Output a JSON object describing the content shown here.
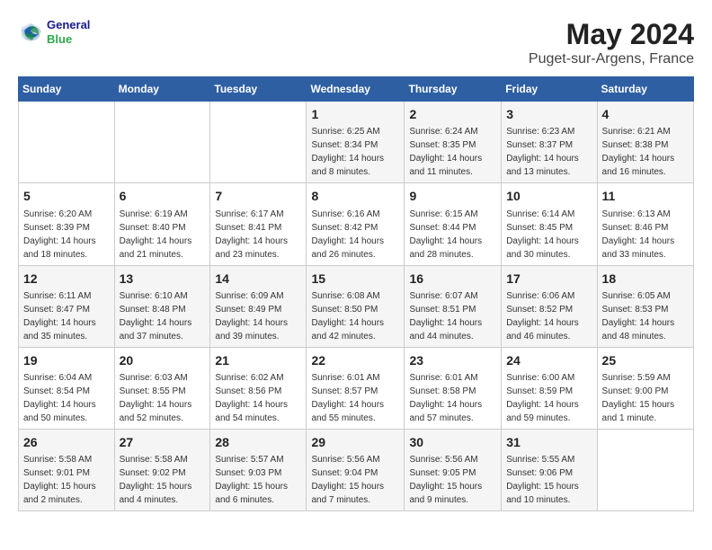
{
  "header": {
    "logo_line1": "General",
    "logo_line2": "Blue",
    "title": "May 2024",
    "subtitle": "Puget-sur-Argens, France"
  },
  "days_of_week": [
    "Sunday",
    "Monday",
    "Tuesday",
    "Wednesday",
    "Thursday",
    "Friday",
    "Saturday"
  ],
  "weeks": [
    [
      {
        "day": "",
        "sunrise": "",
        "sunset": "",
        "daylight": ""
      },
      {
        "day": "",
        "sunrise": "",
        "sunset": "",
        "daylight": ""
      },
      {
        "day": "",
        "sunrise": "",
        "sunset": "",
        "daylight": ""
      },
      {
        "day": "1",
        "sunrise": "Sunrise: 6:25 AM",
        "sunset": "Sunset: 8:34 PM",
        "daylight": "Daylight: 14 hours and 8 minutes."
      },
      {
        "day": "2",
        "sunrise": "Sunrise: 6:24 AM",
        "sunset": "Sunset: 8:35 PM",
        "daylight": "Daylight: 14 hours and 11 minutes."
      },
      {
        "day": "3",
        "sunrise": "Sunrise: 6:23 AM",
        "sunset": "Sunset: 8:37 PM",
        "daylight": "Daylight: 14 hours and 13 minutes."
      },
      {
        "day": "4",
        "sunrise": "Sunrise: 6:21 AM",
        "sunset": "Sunset: 8:38 PM",
        "daylight": "Daylight: 14 hours and 16 minutes."
      }
    ],
    [
      {
        "day": "5",
        "sunrise": "Sunrise: 6:20 AM",
        "sunset": "Sunset: 8:39 PM",
        "daylight": "Daylight: 14 hours and 18 minutes."
      },
      {
        "day": "6",
        "sunrise": "Sunrise: 6:19 AM",
        "sunset": "Sunset: 8:40 PM",
        "daylight": "Daylight: 14 hours and 21 minutes."
      },
      {
        "day": "7",
        "sunrise": "Sunrise: 6:17 AM",
        "sunset": "Sunset: 8:41 PM",
        "daylight": "Daylight: 14 hours and 23 minutes."
      },
      {
        "day": "8",
        "sunrise": "Sunrise: 6:16 AM",
        "sunset": "Sunset: 8:42 PM",
        "daylight": "Daylight: 14 hours and 26 minutes."
      },
      {
        "day": "9",
        "sunrise": "Sunrise: 6:15 AM",
        "sunset": "Sunset: 8:44 PM",
        "daylight": "Daylight: 14 hours and 28 minutes."
      },
      {
        "day": "10",
        "sunrise": "Sunrise: 6:14 AM",
        "sunset": "Sunset: 8:45 PM",
        "daylight": "Daylight: 14 hours and 30 minutes."
      },
      {
        "day": "11",
        "sunrise": "Sunrise: 6:13 AM",
        "sunset": "Sunset: 8:46 PM",
        "daylight": "Daylight: 14 hours and 33 minutes."
      }
    ],
    [
      {
        "day": "12",
        "sunrise": "Sunrise: 6:11 AM",
        "sunset": "Sunset: 8:47 PM",
        "daylight": "Daylight: 14 hours and 35 minutes."
      },
      {
        "day": "13",
        "sunrise": "Sunrise: 6:10 AM",
        "sunset": "Sunset: 8:48 PM",
        "daylight": "Daylight: 14 hours and 37 minutes."
      },
      {
        "day": "14",
        "sunrise": "Sunrise: 6:09 AM",
        "sunset": "Sunset: 8:49 PM",
        "daylight": "Daylight: 14 hours and 39 minutes."
      },
      {
        "day": "15",
        "sunrise": "Sunrise: 6:08 AM",
        "sunset": "Sunset: 8:50 PM",
        "daylight": "Daylight: 14 hours and 42 minutes."
      },
      {
        "day": "16",
        "sunrise": "Sunrise: 6:07 AM",
        "sunset": "Sunset: 8:51 PM",
        "daylight": "Daylight: 14 hours and 44 minutes."
      },
      {
        "day": "17",
        "sunrise": "Sunrise: 6:06 AM",
        "sunset": "Sunset: 8:52 PM",
        "daylight": "Daylight: 14 hours and 46 minutes."
      },
      {
        "day": "18",
        "sunrise": "Sunrise: 6:05 AM",
        "sunset": "Sunset: 8:53 PM",
        "daylight": "Daylight: 14 hours and 48 minutes."
      }
    ],
    [
      {
        "day": "19",
        "sunrise": "Sunrise: 6:04 AM",
        "sunset": "Sunset: 8:54 PM",
        "daylight": "Daylight: 14 hours and 50 minutes."
      },
      {
        "day": "20",
        "sunrise": "Sunrise: 6:03 AM",
        "sunset": "Sunset: 8:55 PM",
        "daylight": "Daylight: 14 hours and 52 minutes."
      },
      {
        "day": "21",
        "sunrise": "Sunrise: 6:02 AM",
        "sunset": "Sunset: 8:56 PM",
        "daylight": "Daylight: 14 hours and 54 minutes."
      },
      {
        "day": "22",
        "sunrise": "Sunrise: 6:01 AM",
        "sunset": "Sunset: 8:57 PM",
        "daylight": "Daylight: 14 hours and 55 minutes."
      },
      {
        "day": "23",
        "sunrise": "Sunrise: 6:01 AM",
        "sunset": "Sunset: 8:58 PM",
        "daylight": "Daylight: 14 hours and 57 minutes."
      },
      {
        "day": "24",
        "sunrise": "Sunrise: 6:00 AM",
        "sunset": "Sunset: 8:59 PM",
        "daylight": "Daylight: 14 hours and 59 minutes."
      },
      {
        "day": "25",
        "sunrise": "Sunrise: 5:59 AM",
        "sunset": "Sunset: 9:00 PM",
        "daylight": "Daylight: 15 hours and 1 minute."
      }
    ],
    [
      {
        "day": "26",
        "sunrise": "Sunrise: 5:58 AM",
        "sunset": "Sunset: 9:01 PM",
        "daylight": "Daylight: 15 hours and 2 minutes."
      },
      {
        "day": "27",
        "sunrise": "Sunrise: 5:58 AM",
        "sunset": "Sunset: 9:02 PM",
        "daylight": "Daylight: 15 hours and 4 minutes."
      },
      {
        "day": "28",
        "sunrise": "Sunrise: 5:57 AM",
        "sunset": "Sunset: 9:03 PM",
        "daylight": "Daylight: 15 hours and 6 minutes."
      },
      {
        "day": "29",
        "sunrise": "Sunrise: 5:56 AM",
        "sunset": "Sunset: 9:04 PM",
        "daylight": "Daylight: 15 hours and 7 minutes."
      },
      {
        "day": "30",
        "sunrise": "Sunrise: 5:56 AM",
        "sunset": "Sunset: 9:05 PM",
        "daylight": "Daylight: 15 hours and 9 minutes."
      },
      {
        "day": "31",
        "sunrise": "Sunrise: 5:55 AM",
        "sunset": "Sunset: 9:06 PM",
        "daylight": "Daylight: 15 hours and 10 minutes."
      },
      {
        "day": "",
        "sunrise": "",
        "sunset": "",
        "daylight": ""
      }
    ]
  ]
}
